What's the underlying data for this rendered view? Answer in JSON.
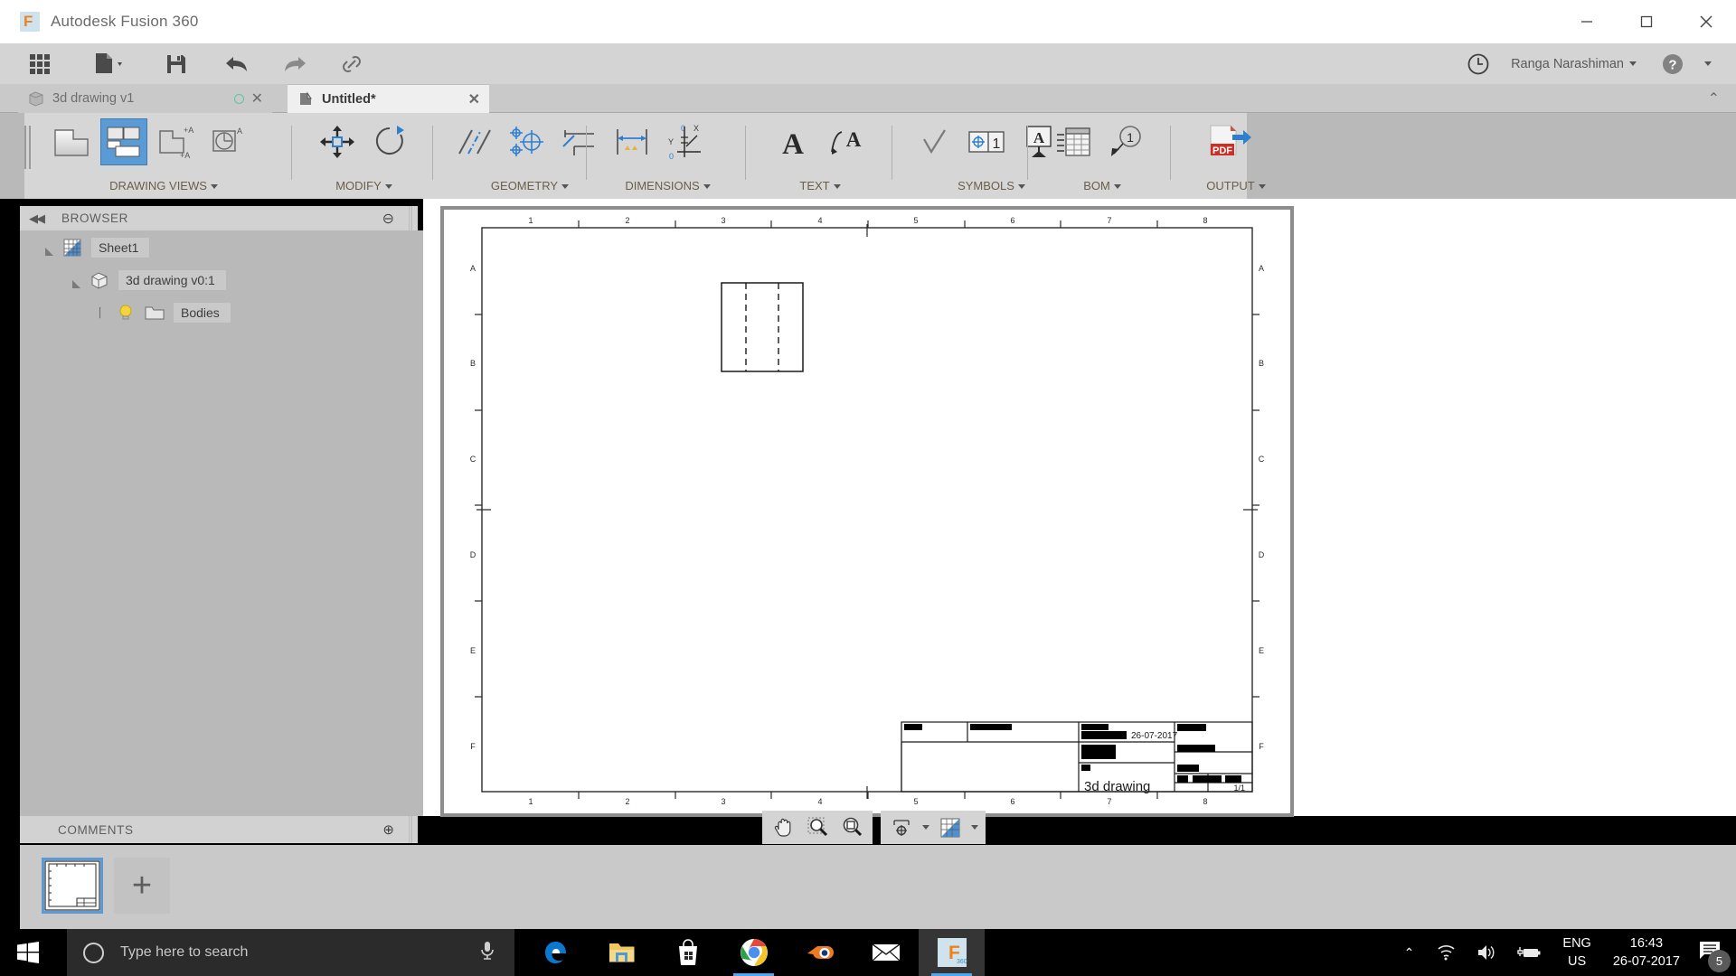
{
  "window": {
    "app_title": "Autodesk Fusion 360",
    "logo_letter": "F",
    "minimize_label": "Minimize",
    "maximize_label": "Maximize",
    "close_label": "Close"
  },
  "quick_access": {
    "items": [
      {
        "name": "app-grid",
        "label": "Show Data Panel"
      },
      {
        "name": "file-menu",
        "label": "File"
      },
      {
        "name": "save",
        "label": "Save"
      },
      {
        "name": "undo",
        "label": "Undo"
      },
      {
        "name": "redo",
        "label": "Redo"
      },
      {
        "name": "link",
        "label": "Link"
      }
    ],
    "history_label": "Job Status",
    "username": "Ranga Narashiman",
    "help_label": "Help"
  },
  "tabs": [
    {
      "label": "3d drawing v1",
      "active": false,
      "modified": false
    },
    {
      "label": "Untitled*",
      "active": true,
      "modified": true
    }
  ],
  "ribbon": {
    "groups": [
      {
        "label": "DRAWING VIEWS",
        "has_dropdown": true,
        "buttons": [
          {
            "name": "base-view-button",
            "label": "Base View",
            "selected": false
          },
          {
            "name": "projected-view-button",
            "label": "Projected View",
            "selected": true
          },
          {
            "name": "detail-view-button",
            "label": "Detail View",
            "selected": false
          },
          {
            "name": "section-view-button",
            "label": "Section View",
            "selected": false
          }
        ]
      },
      {
        "label": "MODIFY",
        "has_dropdown": true,
        "buttons": [
          {
            "name": "move-view-button",
            "label": "Move View",
            "selected": false
          },
          {
            "name": "rotate-view-button",
            "label": "Rotate View",
            "selected": false
          }
        ]
      },
      {
        "label": "GEOMETRY",
        "has_dropdown": true,
        "buttons": [
          {
            "name": "centerline-button",
            "label": "Centerline",
            "selected": false
          },
          {
            "name": "center-mark-button",
            "label": "Center Mark",
            "selected": false
          },
          {
            "name": "edge-extension-button",
            "label": "Edge Extension",
            "selected": false
          }
        ]
      },
      {
        "label": "DIMENSIONS",
        "has_dropdown": true,
        "buttons": [
          {
            "name": "dimension-button",
            "label": "Dimension",
            "selected": false
          },
          {
            "name": "ordinate-dimension-button",
            "label": "Ordinate Dimension",
            "selected": false
          }
        ]
      },
      {
        "label": "TEXT",
        "has_dropdown": true,
        "buttons": [
          {
            "name": "text-button",
            "label": "Text",
            "selected": false
          },
          {
            "name": "leader-text-button",
            "label": "Leader Text",
            "selected": false
          }
        ]
      },
      {
        "label": "SYMBOLS",
        "has_dropdown": true,
        "buttons": [
          {
            "name": "surface-texture-button",
            "label": "Surface Texture",
            "selected": false
          },
          {
            "name": "feature-control-frame-button",
            "label": "Feature Control Frame",
            "selected": false
          },
          {
            "name": "datum-identifier-button",
            "label": "Datum Identifier",
            "selected": false
          }
        ]
      },
      {
        "label": "BOM",
        "has_dropdown": true,
        "buttons": [
          {
            "name": "table-button",
            "label": "Table",
            "selected": false
          },
          {
            "name": "balloon-button",
            "label": "Balloon",
            "selected": false
          }
        ]
      },
      {
        "label": "OUTPUT",
        "has_dropdown": true,
        "buttons": [
          {
            "name": "output-pdf-button",
            "label": "Output PDF",
            "selected": false
          }
        ]
      }
    ]
  },
  "browser": {
    "title": "BROWSER",
    "collapse_label": "Collapse",
    "minimize_label": "Minimize",
    "tree": [
      {
        "label": "Sheet1",
        "icon": "sheet-icon",
        "depth": 0,
        "expanded": true
      },
      {
        "label": "3d drawing v0:1",
        "icon": "component-icon",
        "depth": 1,
        "expanded": true
      },
      {
        "label": "Bodies",
        "icon": "folder-icon",
        "depth": 2,
        "expanded": false,
        "has_bulb": true
      }
    ]
  },
  "comments": {
    "title": "COMMENTS",
    "add_label": "Add Comment"
  },
  "drawing": {
    "zone_letters_left": [
      "A",
      "B",
      "C",
      "D",
      "E",
      "F"
    ],
    "zone_letters_right": [
      "A",
      "B",
      "C",
      "D",
      "E",
      "F"
    ],
    "zone_numbers_top": [
      "1",
      "2",
      "3",
      "4",
      "5",
      "6",
      "7",
      "8"
    ],
    "zone_numbers_bottom": [
      "1",
      "2",
      "3",
      "4",
      "5",
      "6",
      "7",
      "8"
    ],
    "title_block": {
      "drawn_by": "",
      "drawn_by_redacted": true,
      "date": "26-07-2017",
      "drawing_title": "3d drawing",
      "sheet_number": "1/1"
    },
    "view": {
      "name": "front-view",
      "hidden_line_count": 2
    }
  },
  "navigation_bar": {
    "buttons": [
      {
        "name": "pan-icon",
        "label": "Pan"
      },
      {
        "name": "zoom-window-icon",
        "label": "Zoom Window"
      },
      {
        "name": "zoom-fit-icon",
        "label": "Fit"
      },
      {
        "name": "display-settings-icon",
        "label": "Display Settings"
      },
      {
        "name": "sheet-settings-icon",
        "label": "Sheet Settings"
      }
    ]
  },
  "sheet_tabs": {
    "sheets": [
      {
        "name": "Sheet1",
        "active": true
      }
    ],
    "add_label": "+"
  },
  "taskbar": {
    "start_label": "Start",
    "search_placeholder": "Type here to search",
    "search_value": "",
    "cortana_label": "Cortana",
    "mic_label": "Microphone",
    "apps": [
      {
        "name": "edge-icon",
        "label": "Microsoft Edge",
        "running": false,
        "active": false
      },
      {
        "name": "file-explorer-icon",
        "label": "File Explorer",
        "running": false,
        "active": false
      },
      {
        "name": "store-icon",
        "label": "Microsoft Store",
        "running": false,
        "active": false
      },
      {
        "name": "chrome-icon",
        "label": "Google Chrome",
        "running": true,
        "active": false
      },
      {
        "name": "blender-icon",
        "label": "Blender",
        "running": false,
        "active": false
      },
      {
        "name": "mail-icon",
        "label": "Mail",
        "running": false,
        "active": false
      },
      {
        "name": "fusion360-icon",
        "label": "Autodesk Fusion 360",
        "running": true,
        "active": true
      }
    ],
    "tray": {
      "show_hidden_label": "Show hidden icons",
      "network_label": "Network",
      "volume_label": "Volume",
      "battery_label": "Battery",
      "lang_line1": "ENG",
      "lang_line2": "US",
      "time": "16:43",
      "date": "26-07-2017",
      "notification_count": "5"
    }
  },
  "colors": {
    "accent": "#5b9bd5",
    "ribbon_bg": "#d6d6d6",
    "panel_bg": "#b9b9b9",
    "taskbar_bg": "#000000",
    "label_text": "#6b5e49",
    "fusion_orange": "#f0801a"
  }
}
